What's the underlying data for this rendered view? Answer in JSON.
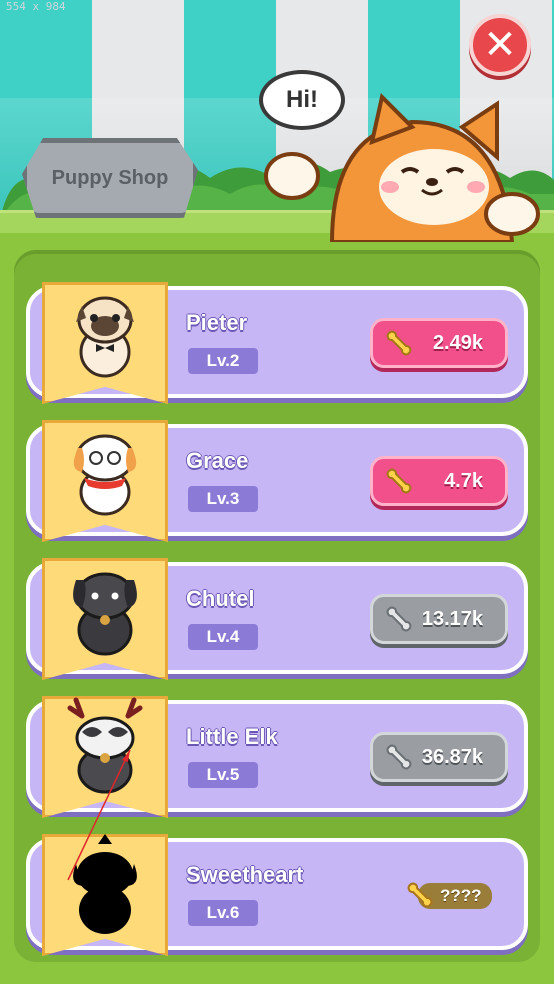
{
  "screen_label": "554 x 984",
  "header": {
    "sign_label": "Puppy Shop",
    "speech_bubble": "Hi!",
    "close_icon": "close-icon"
  },
  "colors": {
    "awning_teal": "#3fd0c6",
    "grass": "#8cc63f",
    "card_purple": "#c6b6f5",
    "price_pink": "#f2508a",
    "price_gray": "#9a9ea2",
    "close_red": "#e8474c"
  },
  "pets": [
    {
      "name": "Pieter",
      "level": "Lv.2",
      "price": "2.49k",
      "price_style": "pink",
      "icon": "pug-icon"
    },
    {
      "name": "Grace",
      "level": "Lv.3",
      "price": "4.7k",
      "price_style": "pink",
      "icon": "white-dog-icon"
    },
    {
      "name": "Chutel",
      "level": "Lv.4",
      "price": "13.17k",
      "price_style": "gray",
      "icon": "black-dog-icon"
    },
    {
      "name": "Little Elk",
      "level": "Lv.5",
      "price": "36.87k",
      "price_style": "gray",
      "icon": "elk-dog-icon"
    },
    {
      "name": "Sweetheart",
      "level": "Lv.6",
      "price": "????",
      "price_style": "locked",
      "icon": "silhouette-dog-icon"
    }
  ]
}
